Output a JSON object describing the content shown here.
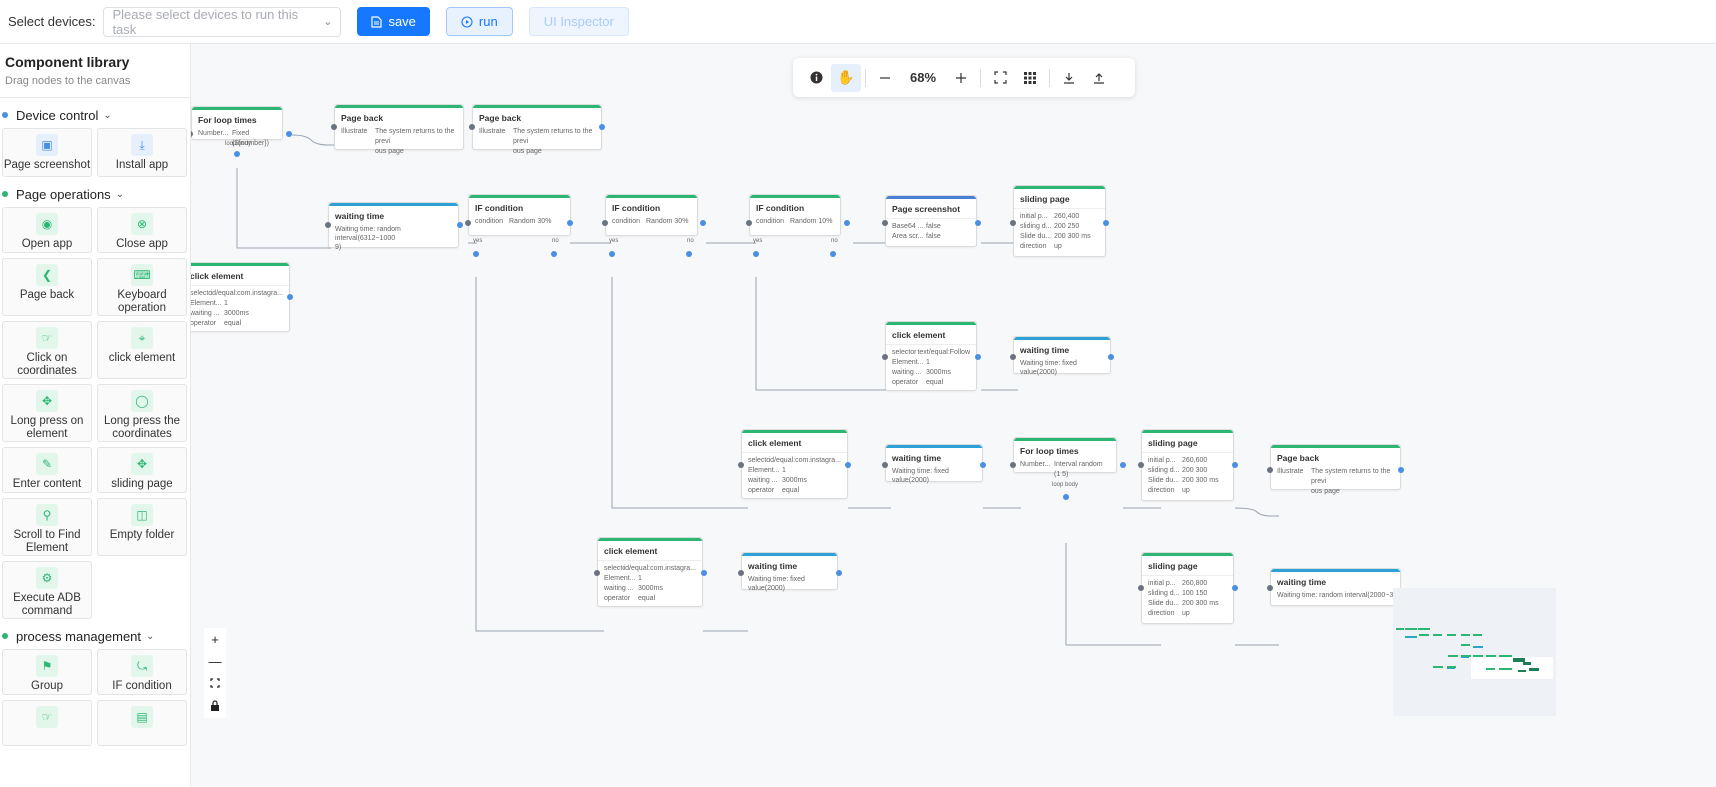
{
  "topbar": {
    "select_label": "Select devices:",
    "select_placeholder": "Please select devices to run this task",
    "save_label": "save",
    "run_label": "run",
    "inspector_label": "UI Inspector"
  },
  "sidebar": {
    "title": "Component library",
    "subtitle": "Drag nodes to the canvas",
    "groups": [
      {
        "label": "Device control",
        "items": [
          "Page screenshot",
          "Install app"
        ]
      },
      {
        "label": "Page operations",
        "items": [
          "Open app",
          "Close app",
          "Page back",
          "Keyboard operation",
          "Click on coordinates",
          "click element",
          "Long press on element",
          "Long press the coordinates",
          "Enter content",
          "sliding page",
          "Scroll to Find Element",
          "Empty folder",
          "Execute ADB command"
        ]
      },
      {
        "label": "process management",
        "items": [
          "Group",
          "IF condition"
        ]
      }
    ]
  },
  "toolbar": {
    "zoom": "68%"
  },
  "nodes": {
    "loop1": {
      "title": "For loop times",
      "k1": "Number...",
      "v1": "Fixed (${number})",
      "port": "loop body"
    },
    "pb1": {
      "title": "Page back",
      "k1": "Illustrate",
      "v1": "The system returns to the previ",
      "v1b": "ous page"
    },
    "pb2": {
      "title": "Page back",
      "k1": "Illustrate",
      "v1": "The system returns to the previ",
      "v1b": "ous page"
    },
    "wait1": {
      "title": "waiting time",
      "l1": "Waiting time: random interval(6312~1000",
      "l2": "9)"
    },
    "click1": {
      "title": "click element",
      "k1": "selector",
      "v1": "id/equal:com.instagra...",
      "k2": "Element...",
      "v2": "1",
      "k3": "waiting ...",
      "v3": "3000ms",
      "k4": "operator",
      "v4": "equal"
    },
    "if1": {
      "title": "IF condition",
      "k1": "condition",
      "v1": "Random 30%",
      "yes": "yes",
      "no": "no"
    },
    "if2": {
      "title": "IF condition",
      "k1": "condition",
      "v1": "Random 30%",
      "yes": "yes",
      "no": "no"
    },
    "if3": {
      "title": "IF condition",
      "k1": "condition",
      "v1": "Random 10%",
      "yes": "yes",
      "no": "no"
    },
    "shot": {
      "title": "Page screenshot",
      "k1": "Base64 ...",
      "v1": "false",
      "k2": "Area scr...",
      "v2": "false"
    },
    "slide1": {
      "title": "sliding page",
      "k1": "initial p...",
      "v1": "260,400",
      "k2": "sliding d...",
      "v2": "200   250",
      "k3": "Slide du...",
      "v3": "200   300 ms",
      "k4": "direction",
      "v4": "up"
    },
    "click2": {
      "title": "click element",
      "k1": "selector",
      "v1": "text/equal:Follow",
      "k2": "Element...",
      "v2": "1",
      "k3": "waiting ...",
      "v3": "3000ms",
      "k4": "operator",
      "v4": "equal"
    },
    "wait2": {
      "title": "waiting time",
      "l1": "Waiting time: fixed value(2000)"
    },
    "click3": {
      "title": "click element",
      "k1": "selector",
      "v1": "id/equal:com.instagra...",
      "k2": "Element...",
      "v2": "1",
      "k3": "waiting ...",
      "v3": "3000ms",
      "k4": "operator",
      "v4": "equal"
    },
    "wait3": {
      "title": "waiting time",
      "l1": "Waiting time: fixed value(2000)"
    },
    "loop2": {
      "title": "For loop times",
      "k1": "Number...",
      "v1": "Interval random (1   5)",
      "port": "loop body"
    },
    "slide2": {
      "title": "sliding page",
      "k1": "initial p...",
      "v1": "260,600",
      "k2": "sliding d...",
      "v2": "200   300",
      "k3": "Slide du...",
      "v3": "200   300 ms",
      "k4": "direction",
      "v4": "up"
    },
    "pb3": {
      "title": "Page back",
      "k1": "Illustrate",
      "v1": "The system returns to the previ",
      "v1b": "ous page"
    },
    "click4": {
      "title": "click element",
      "k1": "selector",
      "v1": "id/equal:com.instagra...",
      "k2": "Element...",
      "v2": "1",
      "k3": "waiting ...",
      "v3": "3000ms",
      "k4": "operator",
      "v4": "equal"
    },
    "wait4": {
      "title": "waiting time",
      "l1": "Waiting time: fixed value(2000)"
    },
    "slide3": {
      "title": "sliding page",
      "k1": "initial p...",
      "v1": "260,800",
      "k2": "sliding d...",
      "v2": "100   150",
      "k3": "Slide du...",
      "v3": "200   300 ms",
      "k4": "direction",
      "v4": "up"
    },
    "wait5": {
      "title": "waiting time",
      "l1": "Waiting time: random interval(2000~3000"
    }
  },
  "colors": {
    "primary": "#1677ff",
    "green": "#2bb673",
    "blue": "#2da0d8"
  }
}
